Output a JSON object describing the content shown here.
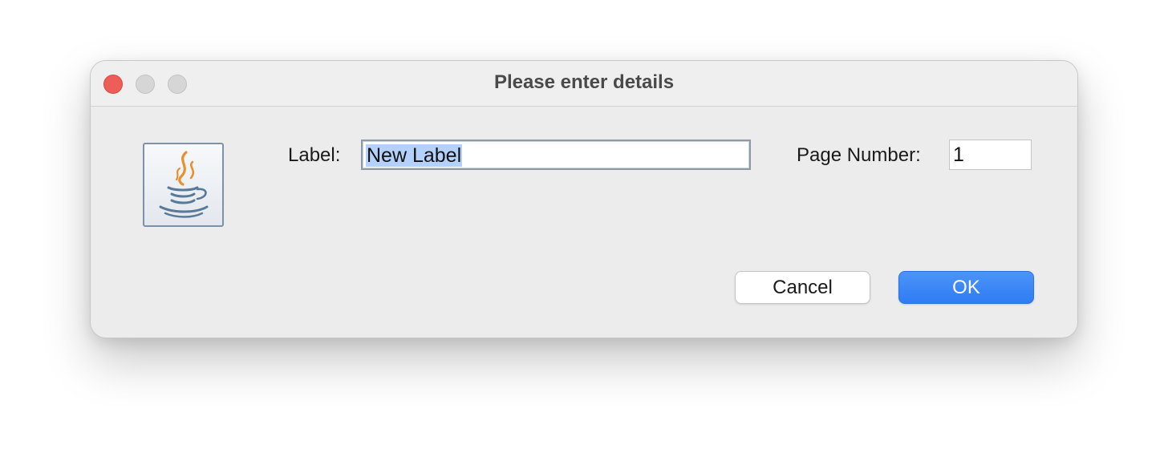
{
  "window": {
    "title": "Please enter details"
  },
  "form": {
    "label_caption": "Label:",
    "label_value": "New Label",
    "page_caption": "Page Number:",
    "page_value": "1"
  },
  "buttons": {
    "cancel": "Cancel",
    "ok": "OK"
  },
  "icons": {
    "dialog_icon": "java-coffee-cup-icon",
    "close": "close-window-icon",
    "minimize": "minimize-window-icon",
    "zoom": "zoom-window-icon"
  },
  "colors": {
    "accent": "#3a86f6",
    "selection": "#b3d1fa",
    "close_button": "#ee5e58"
  }
}
